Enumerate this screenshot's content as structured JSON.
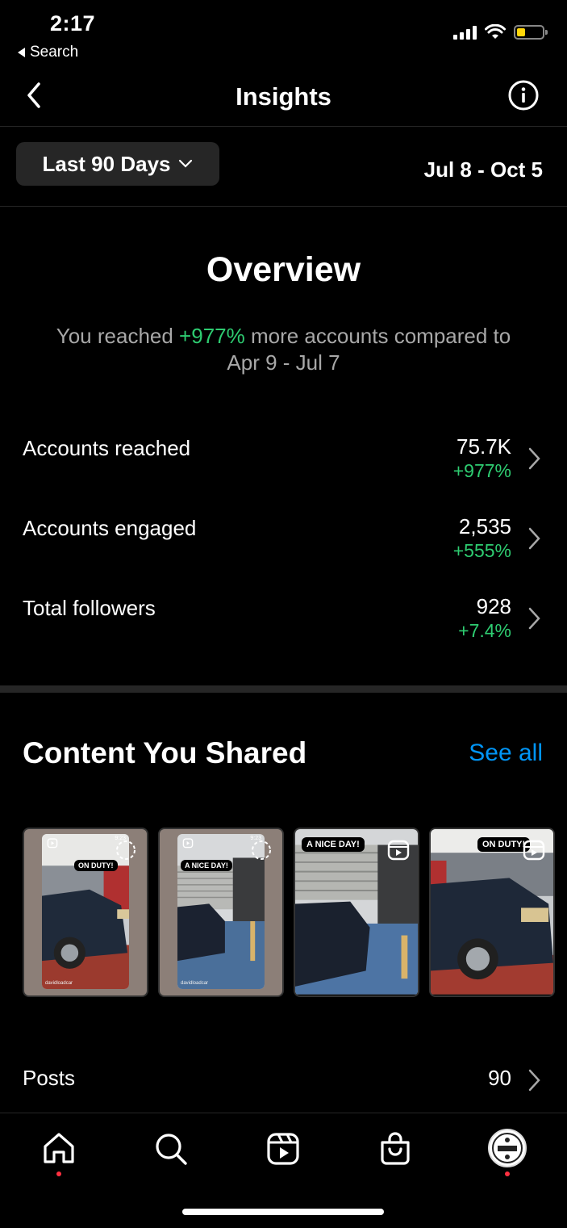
{
  "status": {
    "time": "2:17",
    "back_app": "Search"
  },
  "header": {
    "title": "Insights"
  },
  "range": {
    "selector": "Last 90 Days",
    "dates": "Jul 8 - Oct 5"
  },
  "overview": {
    "title": "Overview",
    "sub_prefix": "You reached ",
    "sub_change": "+977%",
    "sub_suffix": " more accounts compared to Apr 9 - Jul 7",
    "metrics": [
      {
        "label": "Accounts reached",
        "value": "75.7K",
        "change": "+977%"
      },
      {
        "label": "Accounts engaged",
        "value": "2,535",
        "change": "+555%"
      },
      {
        "label": "Total followers",
        "value": "928",
        "change": "+7.4%"
      }
    ]
  },
  "content": {
    "title": "Content You Shared",
    "see_all": "See all",
    "thumbs": [
      {
        "tag": "ON DUTY!",
        "handle": "davidloadcar",
        "time": "9:23"
      },
      {
        "tag": "A NICE DAY!",
        "handle": "davidloadcar",
        "time": "9:23"
      },
      {
        "tag": "A NICE DAY!"
      },
      {
        "tag": "ON DUTY!"
      }
    ],
    "posts": {
      "label": "Posts",
      "value": "90"
    }
  },
  "colors": {
    "positive": "#2ecc71",
    "link": "#0095f6",
    "notification_dot": "#ff3040",
    "battery": "#ffd60a"
  },
  "tabs": [
    "home-icon",
    "search-icon",
    "reels-icon",
    "shop-icon",
    "profile-avatar"
  ]
}
